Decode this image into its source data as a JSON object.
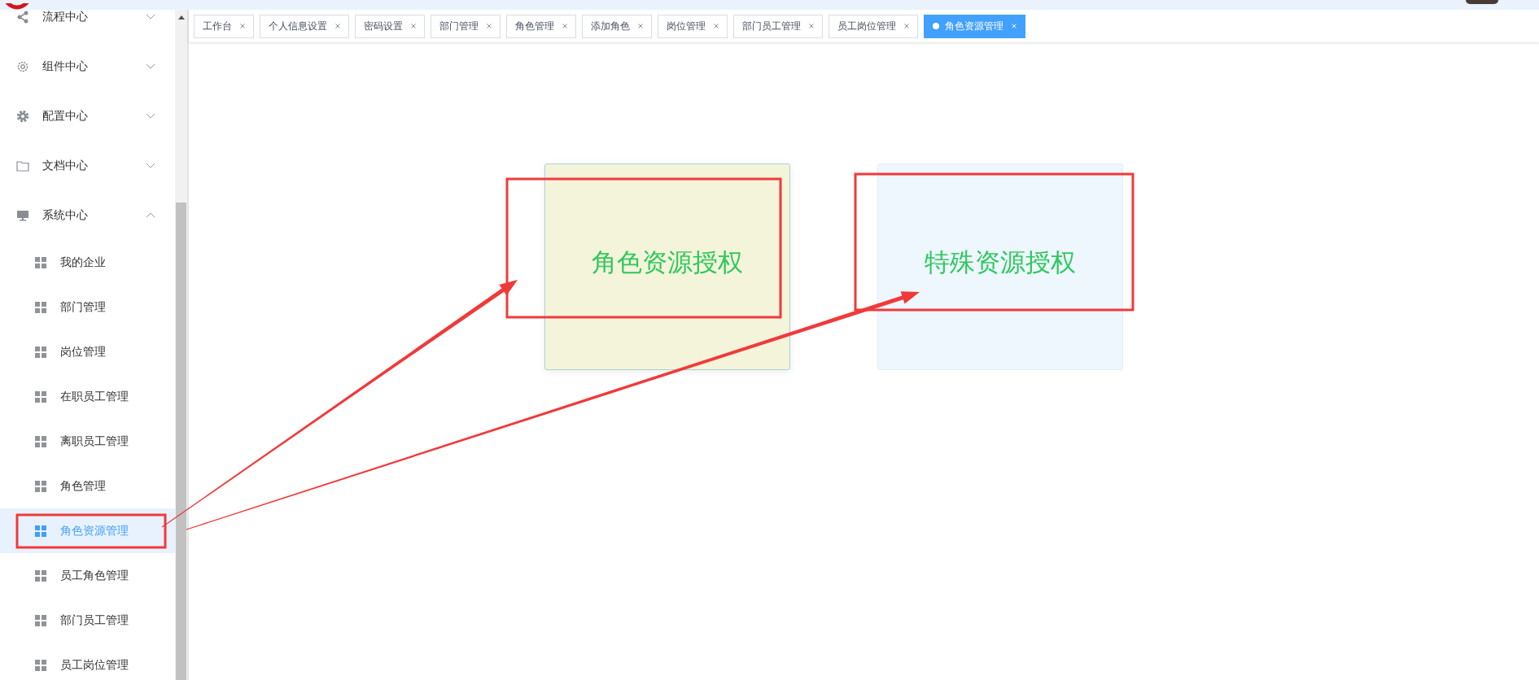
{
  "sidebar": {
    "items": [
      {
        "label": "流程中心",
        "expanded": false
      },
      {
        "label": "组件中心",
        "expanded": false
      },
      {
        "label": "配置中心",
        "expanded": false
      },
      {
        "label": "文档中心",
        "expanded": false
      },
      {
        "label": "系统中心",
        "expanded": true,
        "children": [
          {
            "label": "我的企业",
            "selected": false
          },
          {
            "label": "部门管理",
            "selected": false
          },
          {
            "label": "岗位管理",
            "selected": false
          },
          {
            "label": "在职员工管理",
            "selected": false
          },
          {
            "label": "离职员工管理",
            "selected": false
          },
          {
            "label": "角色管理",
            "selected": false
          },
          {
            "label": "角色资源管理",
            "selected": true
          },
          {
            "label": "员工角色管理",
            "selected": false
          },
          {
            "label": "部门员工管理",
            "selected": false
          },
          {
            "label": "员工岗位管理",
            "selected": false
          }
        ]
      }
    ]
  },
  "tabs": [
    {
      "label": "工作台",
      "selected": false
    },
    {
      "label": "个人信息设置",
      "selected": false
    },
    {
      "label": "密码设置",
      "selected": false
    },
    {
      "label": "部门管理",
      "selected": false
    },
    {
      "label": "角色管理",
      "selected": false
    },
    {
      "label": "添加角色",
      "selected": false
    },
    {
      "label": "岗位管理",
      "selected": false
    },
    {
      "label": "部门员工管理",
      "selected": false
    },
    {
      "label": "员工岗位管理",
      "selected": false
    },
    {
      "label": "角色资源管理",
      "selected": true
    }
  ],
  "cards": [
    {
      "label": "角色资源授权",
      "color": "#f4f4da"
    },
    {
      "label": "特殊资源授权",
      "color": "#eef6fe"
    }
  ]
}
